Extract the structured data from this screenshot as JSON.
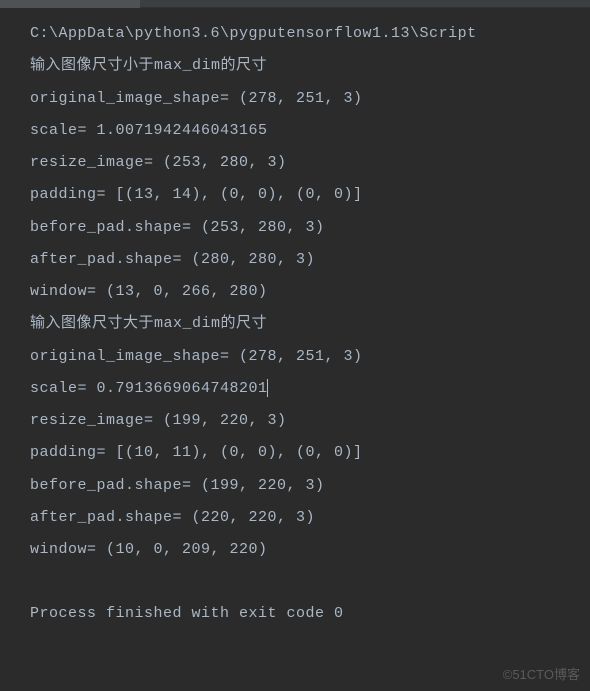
{
  "console": {
    "lines": [
      "C:\\AppData\\python3.6\\pygputensorflow1.13\\Script",
      "输入图像尺寸小于max_dim的尺寸",
      "original_image_shape= (278, 251, 3)",
      "scale= 1.0071942446043165",
      "resize_image= (253, 280, 3)",
      "padding= [(13, 14), (0, 0), (0, 0)]",
      "before_pad.shape= (253, 280, 3)",
      "after_pad.shape= (280, 280, 3)",
      "window= (13, 0, 266, 280)",
      "输入图像尺寸大于max_dim的尺寸",
      "original_image_shape= (278, 251, 3)",
      "scale= 0.7913669064748201",
      "resize_image= (199, 220, 3)",
      "padding= [(10, 11), (0, 0), (0, 0)]",
      "before_pad.shape= (199, 220, 3)",
      "after_pad.shape= (220, 220, 3)",
      "window= (10, 0, 209, 220)",
      "",
      "Process finished with exit code 0"
    ],
    "cursor_line_index": 11
  },
  "watermark": "©51CTO博客"
}
